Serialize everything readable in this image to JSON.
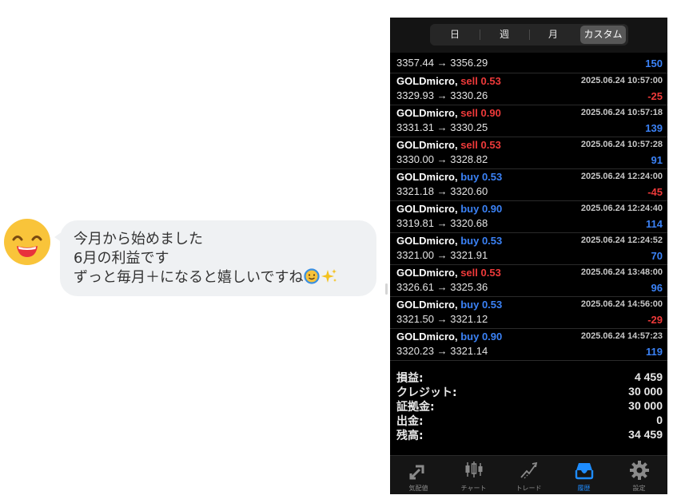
{
  "chat": {
    "avatar_icon": "grinning-face-icon",
    "line1": "今月から始めました",
    "line2": "6月の利益です",
    "line3": "ずっと毎月＋になると嬉しいですね",
    "emoji_icons": [
      "smiling-face-icon",
      "sparkles-icon"
    ]
  },
  "app": {
    "segments": [
      "日",
      "週",
      "月",
      "カスタム"
    ],
    "active_segment": "カスタム",
    "partial_row": {
      "price": "3357.44 → 3356.29",
      "profit": "150"
    },
    "trades": [
      {
        "symbol": "GOLDmicro,",
        "side": "sell",
        "volume": "0.53",
        "time": "2025.06.24 10:57:00",
        "price": "3329.93 → 3330.26",
        "profit": "-25"
      },
      {
        "symbol": "GOLDmicro,",
        "side": "sell",
        "volume": "0.90",
        "time": "2025.06.24 10:57:18",
        "price": "3331.31 → 3330.25",
        "profit": "139"
      },
      {
        "symbol": "GOLDmicro,",
        "side": "sell",
        "volume": "0.53",
        "time": "2025.06.24 10:57:28",
        "price": "3330.00 → 3328.82",
        "profit": "91"
      },
      {
        "symbol": "GOLDmicro,",
        "side": "buy",
        "volume": "0.53",
        "time": "2025.06.24 12:24:00",
        "price": "3321.18 → 3320.60",
        "profit": "-45"
      },
      {
        "symbol": "GOLDmicro,",
        "side": "buy",
        "volume": "0.90",
        "time": "2025.06.24 12:24:40",
        "price": "3319.81 → 3320.68",
        "profit": "114"
      },
      {
        "symbol": "GOLDmicro,",
        "side": "buy",
        "volume": "0.53",
        "time": "2025.06.24 12:24:52",
        "price": "3321.00 → 3321.91",
        "profit": "70"
      },
      {
        "symbol": "GOLDmicro,",
        "side": "sell",
        "volume": "0.53",
        "time": "2025.06.24 13:48:00",
        "price": "3326.61 → 3325.36",
        "profit": "96"
      },
      {
        "symbol": "GOLDmicro,",
        "side": "buy",
        "volume": "0.53",
        "time": "2025.06.24 14:56:00",
        "price": "3321.50 → 3321.12",
        "profit": "-29"
      },
      {
        "symbol": "GOLDmicro,",
        "side": "buy",
        "volume": "0.90",
        "time": "2025.06.24 14:57:23",
        "price": "3320.23 → 3321.14",
        "profit": "119"
      }
    ],
    "summary": [
      {
        "label": "損益:",
        "value": "4 459"
      },
      {
        "label": "クレジット:",
        "value": "30 000"
      },
      {
        "label": "証拠金:",
        "value": "30 000"
      },
      {
        "label": "出金:",
        "value": "0"
      },
      {
        "label": "残高:",
        "value": "34 459"
      }
    ],
    "tabs": [
      {
        "label": "気配値",
        "icon": "quotes-arrows-icon"
      },
      {
        "label": "チャート",
        "icon": "candlestick-chart-icon"
      },
      {
        "label": "トレード",
        "icon": "trade-trend-icon"
      },
      {
        "label": "履歴",
        "icon": "history-tray-icon"
      },
      {
        "label": "設定",
        "icon": "gear-icon"
      }
    ],
    "active_tab": "履歴",
    "colors": {
      "sell": "#ee3a3a",
      "buy": "#3b82f6",
      "active_tab": "#1e8cff"
    }
  }
}
